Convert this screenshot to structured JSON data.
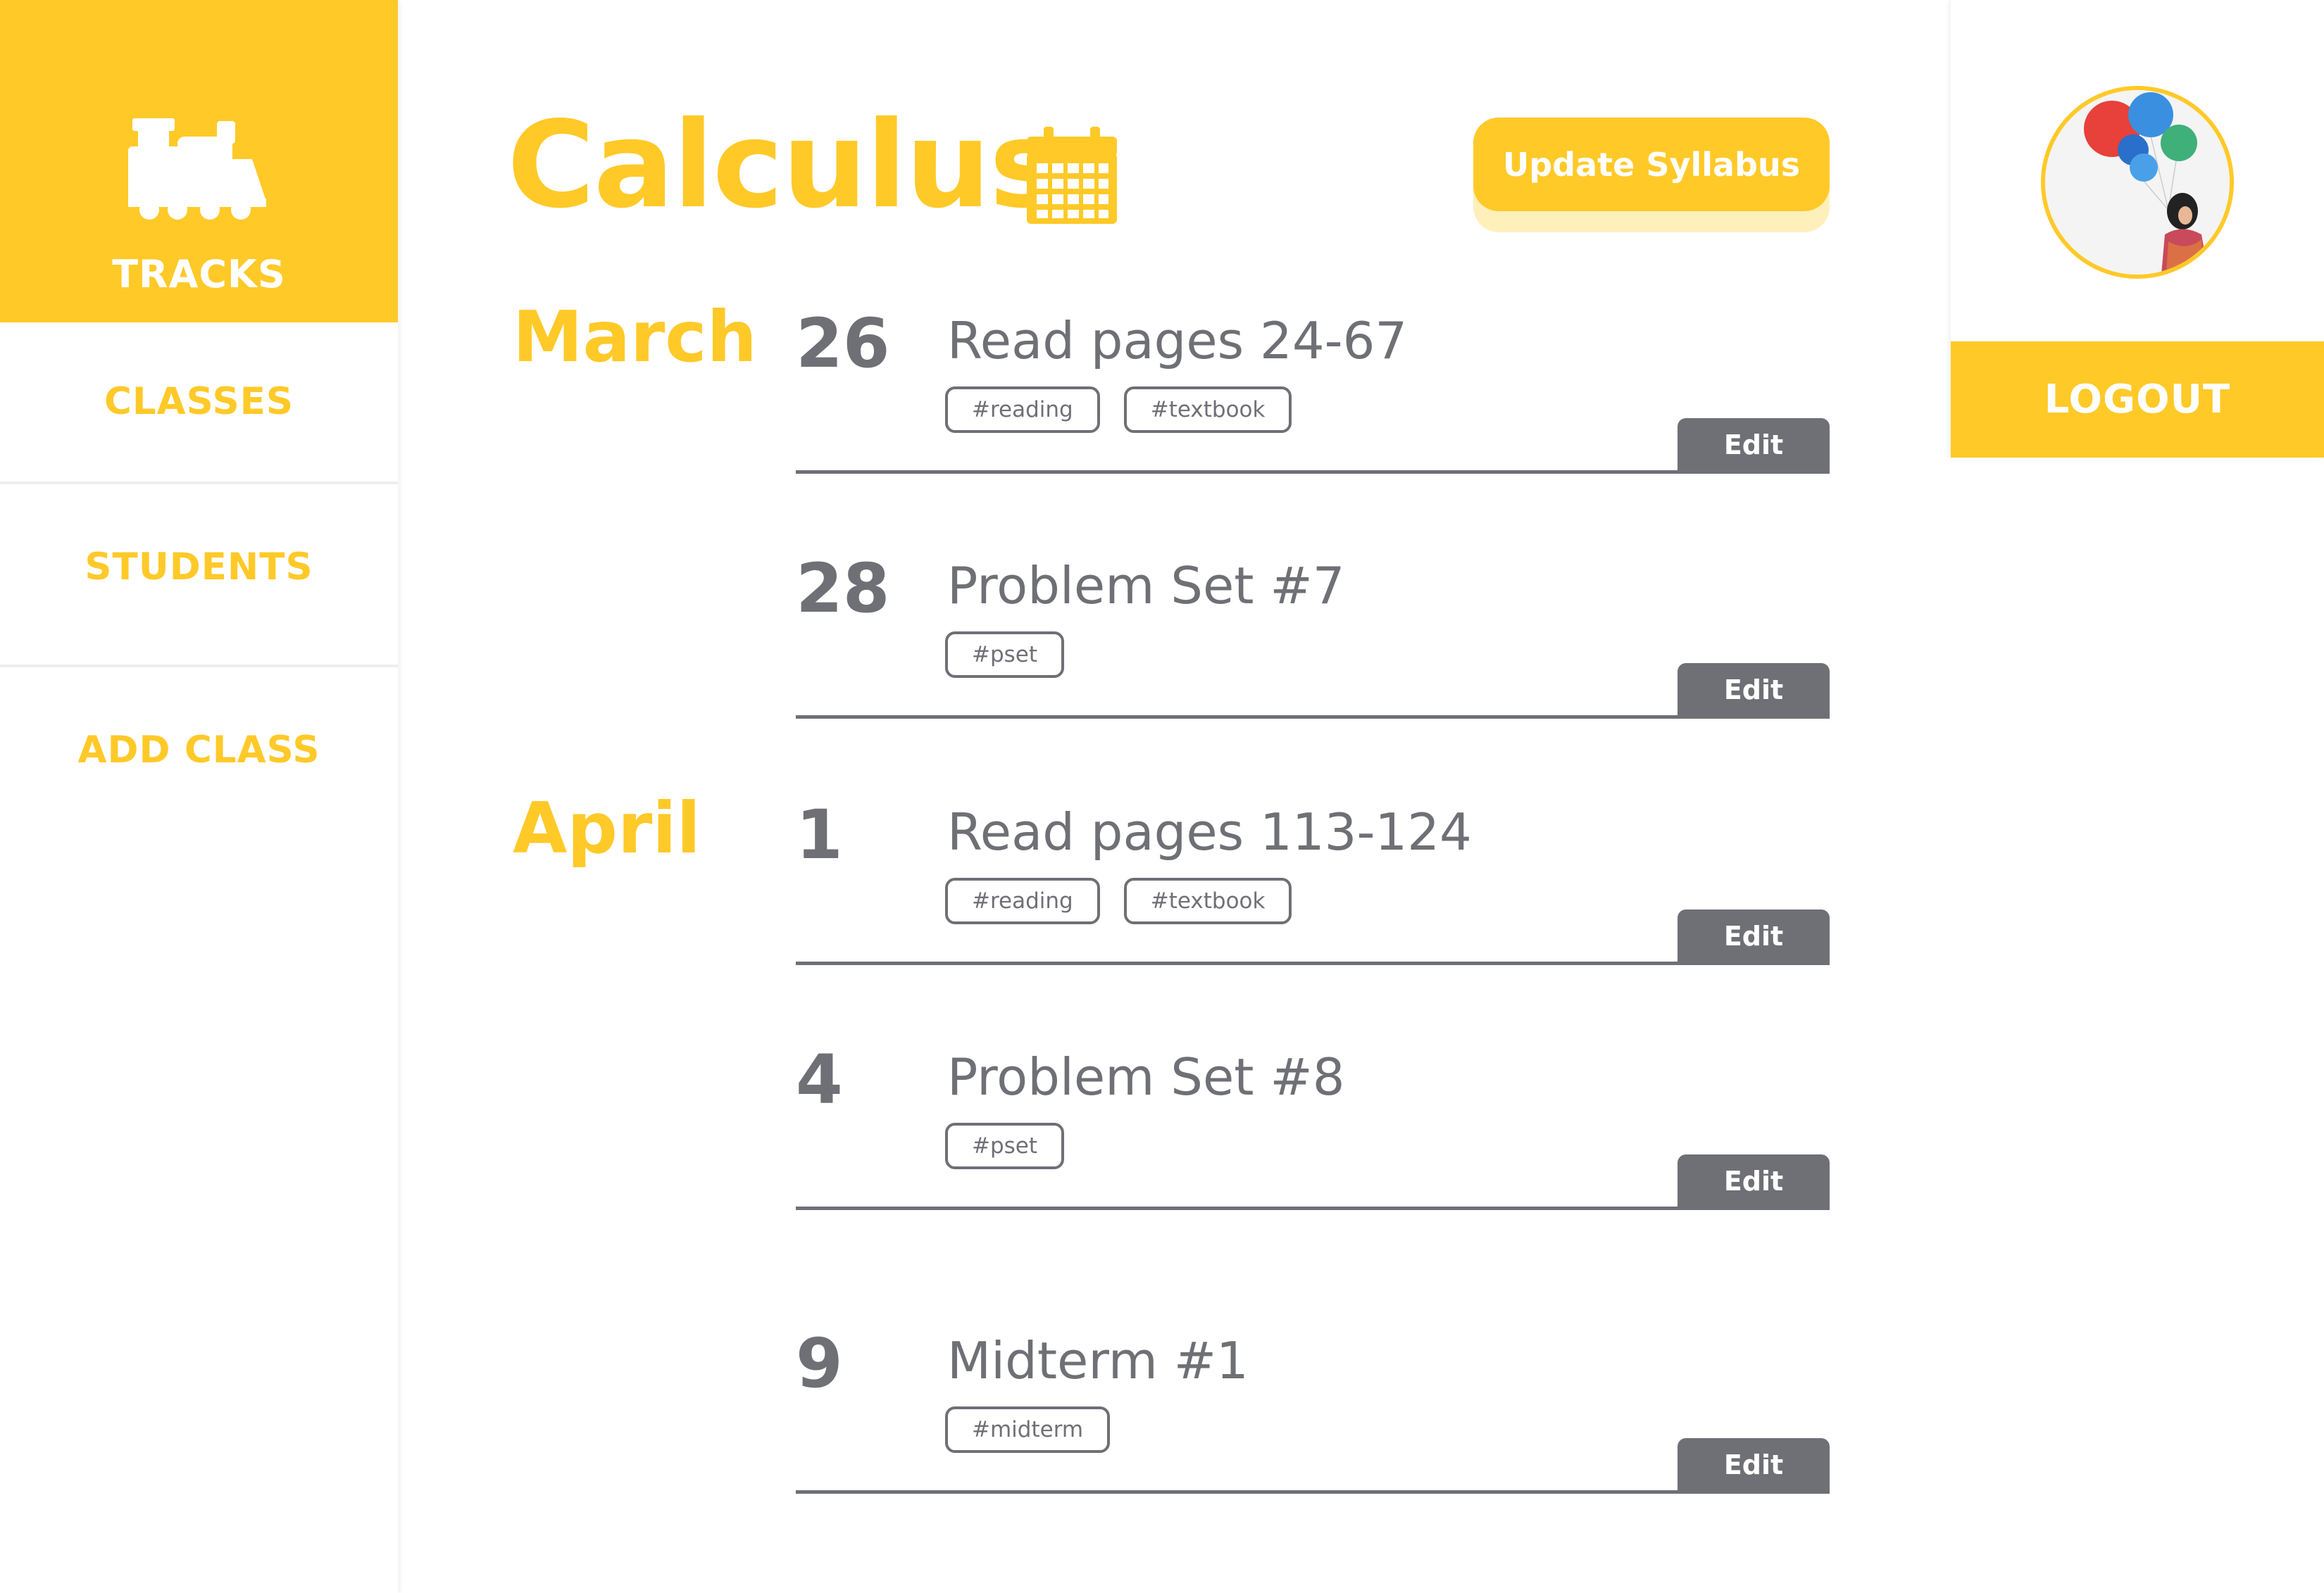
{
  "sidebar": {
    "brand_label": "TRACKS",
    "items": [
      {
        "label": "CLASSES"
      },
      {
        "label": "STUDENTS"
      },
      {
        "label": "ADD CLASS"
      }
    ]
  },
  "header": {
    "title": "Calculus",
    "update_button": "Update Syllabus"
  },
  "profile": {
    "logout_label": "LOGOUT"
  },
  "months": [
    {
      "name": "March",
      "entries": [
        {
          "day": "26",
          "title": "Read pages 24-67",
          "tags": [
            "#reading",
            "#textbook"
          ],
          "edit_label": "Edit"
        },
        {
          "day": "28",
          "title": "Problem Set #7",
          "tags": [
            "#pset"
          ],
          "edit_label": "Edit"
        }
      ]
    },
    {
      "name": "April",
      "entries": [
        {
          "day": "1",
          "title": "Read pages 113-124",
          "tags": [
            "#reading",
            "#textbook"
          ],
          "edit_label": "Edit"
        },
        {
          "day": "4",
          "title": "Problem Set #8",
          "tags": [
            "#pset"
          ],
          "edit_label": "Edit"
        },
        {
          "day": "9",
          "title": "Midterm #1",
          "tags": [
            "#midterm"
          ],
          "edit_label": "Edit"
        }
      ]
    }
  ],
  "colors": {
    "accent": "#ffc928",
    "accent_light": "#fff0bb",
    "text_gray": "#6f7076",
    "background": "#ffffff"
  },
  "icons": {
    "brand": "train-icon",
    "title": "calendar-icon",
    "profile": "avatar"
  }
}
